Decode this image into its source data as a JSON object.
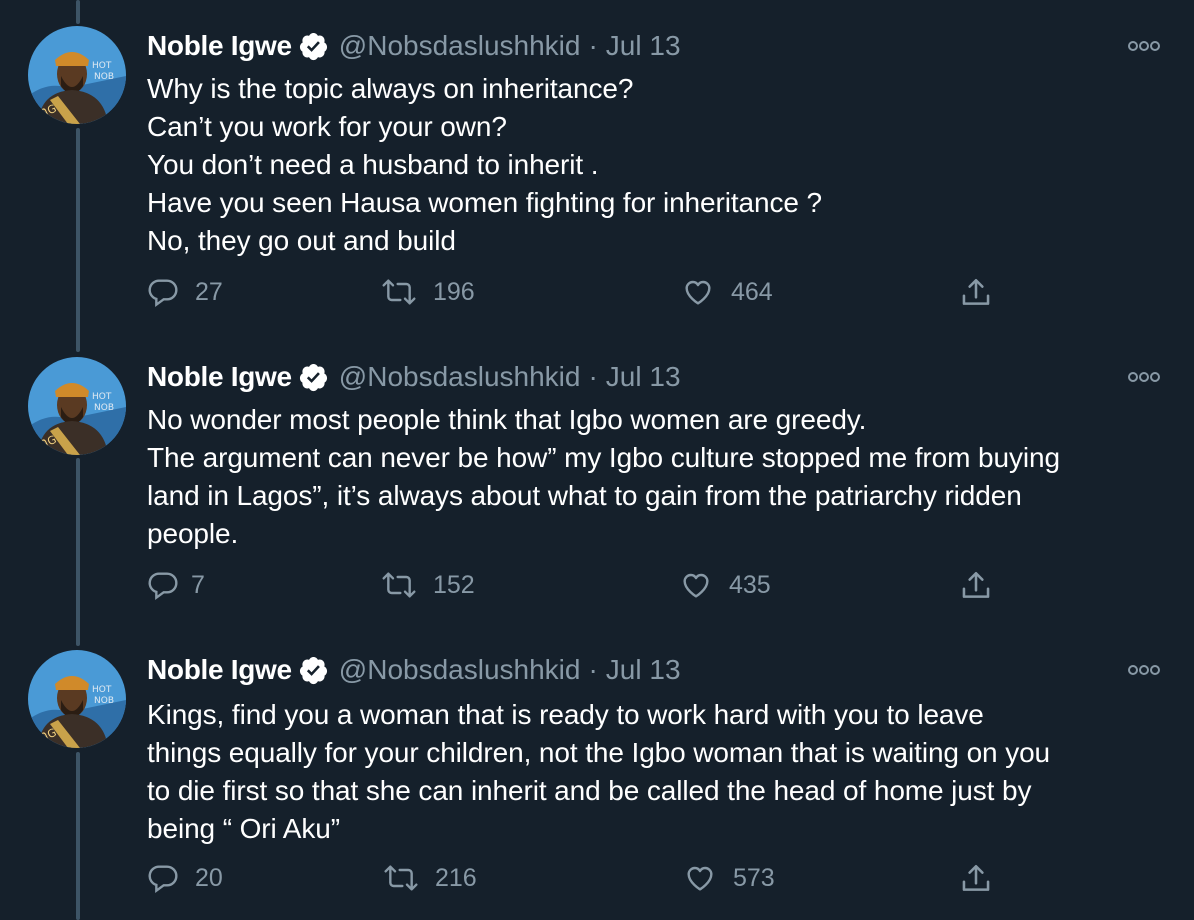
{
  "tweets": [
    {
      "author_name": "Noble Igwe",
      "handle": "@Nobsdaslushhkid",
      "separator": "·",
      "date": "Jul 13",
      "lines": [
        "Why is the topic always on inheritance?",
        "Can’t you work for your own?",
        "You don’t need a husband to inherit .",
        "Have you seen Hausa women fighting for inheritance ?",
        "No, they go out and build"
      ],
      "replies": "27",
      "retweets": "196",
      "likes": "464"
    },
    {
      "author_name": "Noble Igwe",
      "handle": "@Nobsdaslushhkid",
      "separator": "·",
      "date": "Jul 13",
      "lines": [
        "No wonder most people think that Igbo women are greedy.",
        "The argument can never be how” my Igbo culture stopped me from buying",
        "land in Lagos”, it’s always about what to gain from the patriarchy ridden",
        "people."
      ],
      "replies": "7",
      "retweets": "152",
      "likes": "435"
    },
    {
      "author_name": "Noble Igwe",
      "handle": "@Nobsdaslushhkid",
      "separator": "·",
      "date": "Jul 13",
      "lines": [
        "Kings, find you a woman that is ready to work hard with you to leave",
        "things equally for your children, not the Igbo woman that is waiting on you",
        "to die first  so that she can inherit and be called the head of home just by",
        "being “ Ori Aku”"
      ],
      "replies": "20",
      "retweets": "216",
      "likes": "573"
    }
  ],
  "icons": {
    "verified": "verified-badge-icon",
    "more": "more-options-icon",
    "reply": "reply-icon",
    "retweet": "retweet-icon",
    "like": "like-icon",
    "share": "share-icon"
  },
  "colors": {
    "background": "#15202b",
    "text_primary": "#ffffff",
    "text_secondary": "#8899a6",
    "thread_line": "#3d5466"
  }
}
